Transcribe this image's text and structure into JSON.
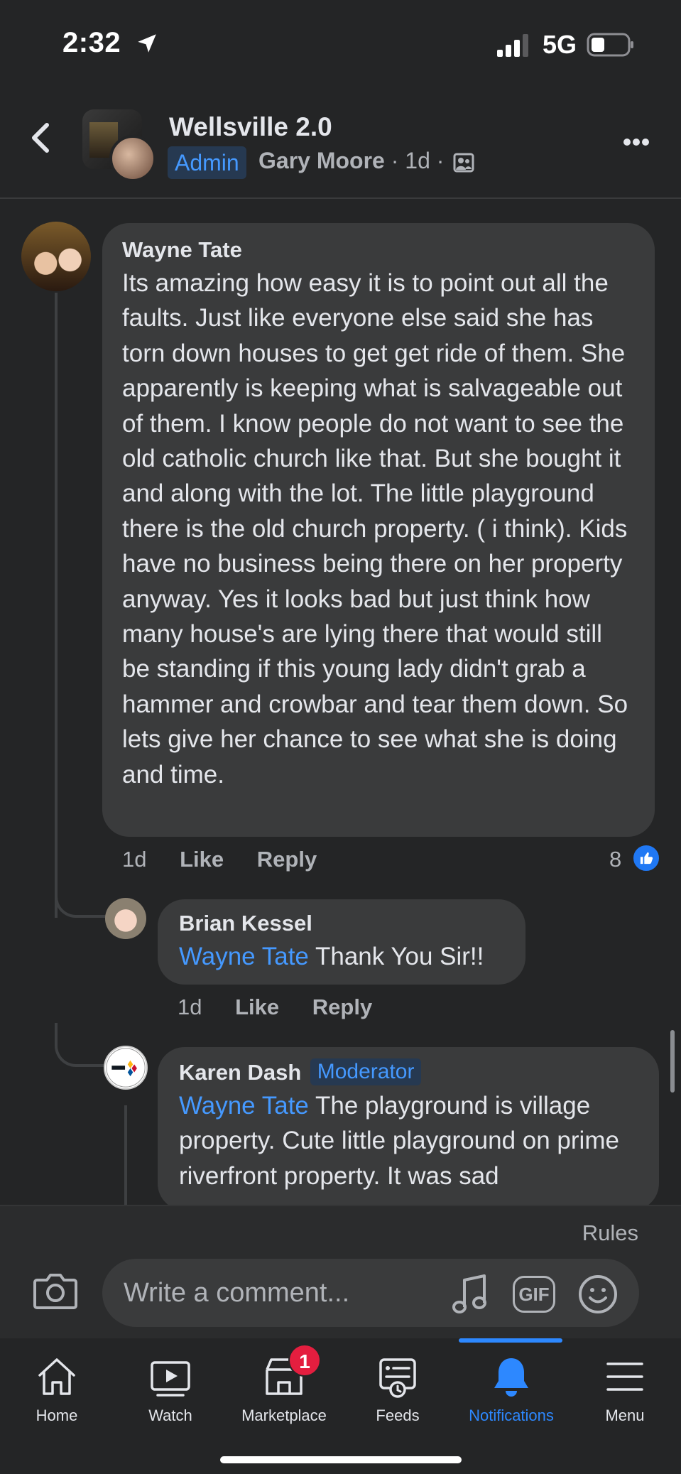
{
  "status_bar": {
    "time": "2:32",
    "network": "5G"
  },
  "header": {
    "group_name": "Wellsville 2.0",
    "badge": "Admin",
    "author": "Gary Moore",
    "timestamp": "1d",
    "separator": "·"
  },
  "comments": [
    {
      "name": "Wayne Tate",
      "text": "Its amazing how easy it is to point out all the faults. Just like everyone else said she has torn down houses to get get ride of them. She apparently is keeping what is salvageable out of them. I know people do not want to see the old catholic church like that. But she bought it and along with the lot. The little playground there is the old church property. ( i think). Kids have no business being there on her property anyway. Yes it looks bad but just think how many house's are lying there that would still be standing if this young lady didn't grab a hammer and crowbar and tear them down. So lets give her chance to see what she is doing and time.",
      "time": "1d",
      "like_label": "Like",
      "reply_label": "Reply",
      "reaction_count": "8"
    },
    {
      "name": "Brian Kessel",
      "mention": "Wayne Tate",
      "text": " Thank You Sir!!",
      "time": "1d",
      "like_label": "Like",
      "reply_label": "Reply"
    },
    {
      "name": "Karen Dash",
      "badge": "Moderator",
      "mention": "Wayne Tate",
      "text": " The playground is village property. Cute little playground on prime riverfront property. It was sad"
    }
  ],
  "composer": {
    "rules_label": "Rules",
    "placeholder": "Write a comment...",
    "gif_label": "GIF"
  },
  "bottom_nav": {
    "items": [
      {
        "label": "Home",
        "icon": "home-icon"
      },
      {
        "label": "Watch",
        "icon": "watch-icon"
      },
      {
        "label": "Marketplace",
        "icon": "marketplace-icon",
        "badge": "1"
      },
      {
        "label": "Feeds",
        "icon": "feeds-icon"
      },
      {
        "label": "Notifications",
        "icon": "bell-icon",
        "active": true
      },
      {
        "label": "Menu",
        "icon": "menu-icon"
      }
    ]
  },
  "colors": {
    "background": "#242526",
    "bubble": "#3a3b3c",
    "accent": "#2d88ff",
    "mention": "#4599ff",
    "badge_red": "#e41e3f"
  }
}
